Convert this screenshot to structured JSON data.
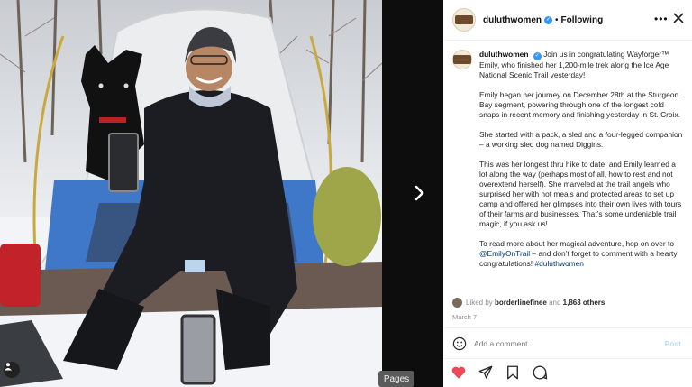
{
  "photo": {
    "alt": "Hiker with dog in snow camp"
  },
  "gutter": {
    "pages_tooltip": "Pages"
  },
  "header": {
    "username": "duluthwomen",
    "separator": "•",
    "follow_status": "Following"
  },
  "caption": {
    "username": "duluthwomen",
    "paragraphs": [
      "Join us in congratulating Wayforger™ Emily, who finished her 1,200-mile trek along the Ice Age National Scenic Trail yesterday!",
      "Emily began her journey on December 28th at the Sturgeon Bay segment, powering through one of the longest cold snaps in recent memory and finishing yesterday in St. Croix.",
      "She started with a pack, a sled and a four-legged companion – a working sled dog named Diggins.",
      "This was her longest thru hike to date, and Emily learned a lot along the way (perhaps most of all, how to rest and not overextend herself). She marveled at the trail angels who surprised her with hot meals and protected areas to set up camp and offered her glimpses into their own lives with tours of their farms and businesses. That’s some undeniable trail magic, if you ask us!"
    ],
    "last_para_a": "To read more about her magical adventure, hop on over to",
    "mention": "@EmilyOnTrail",
    "last_para_b": "– and don’t forget to comment with a hearty congratulations!",
    "hashtag": "#duluthwomen"
  },
  "likes": {
    "prefix": "Liked by",
    "user": "borderlinefinee",
    "conj": "and",
    "others": "1,863 others"
  },
  "date": "March 7",
  "comment": {
    "placeholder": "Add a comment...",
    "post_label": "Post"
  },
  "colors": {
    "verified": "#3897f0",
    "like": "#ed4956",
    "link": "#00376b",
    "post": "#b2dffc"
  },
  "icons": [
    "user-tag-icon",
    "chevron-right-icon",
    "more-icon",
    "close-icon",
    "verified-icon",
    "smiley-icon",
    "heart-icon",
    "share-icon",
    "bookmark-icon",
    "comment-icon"
  ]
}
